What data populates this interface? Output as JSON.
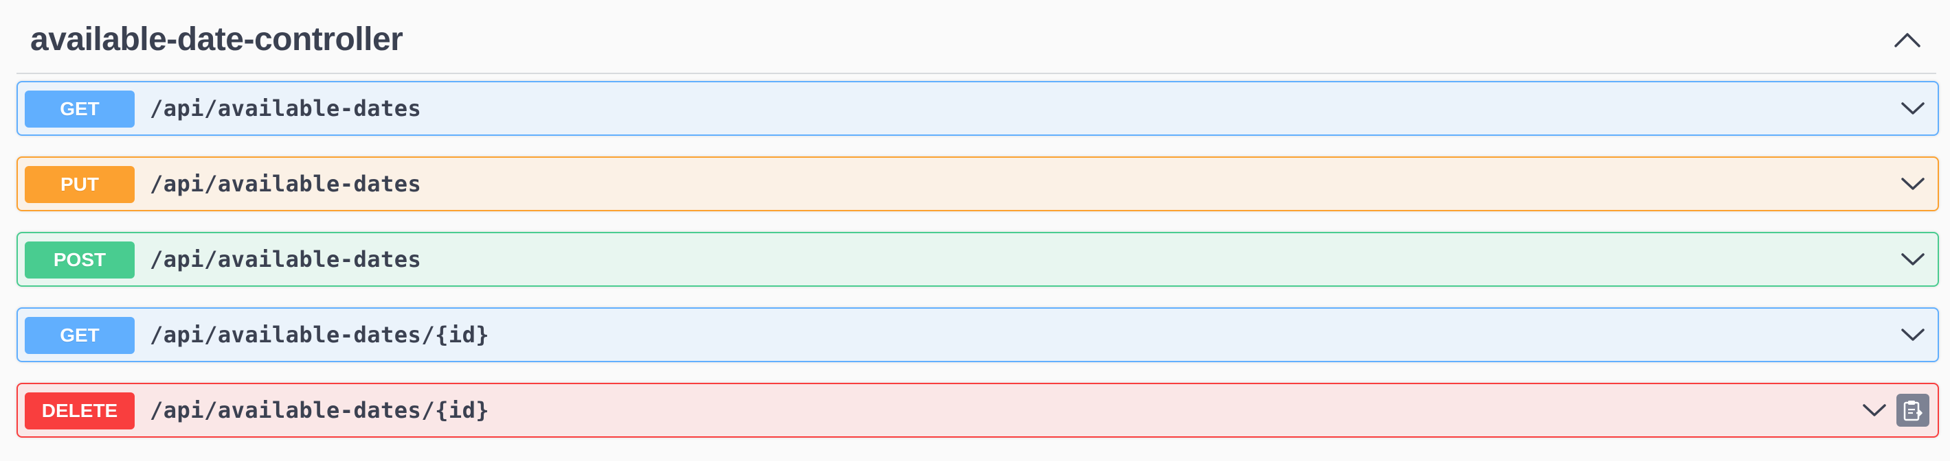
{
  "section": {
    "title": "available-date-controller"
  },
  "operations": [
    {
      "method": "GET",
      "path": "/api/available-dates"
    },
    {
      "method": "PUT",
      "path": "/api/available-dates"
    },
    {
      "method": "POST",
      "path": "/api/available-dates"
    },
    {
      "method": "GET",
      "path": "/api/available-dates/{id}"
    },
    {
      "method": "DELETE",
      "path": "/api/available-dates/{id}"
    }
  ],
  "icons": {
    "section_toggle": "chevron-up-icon",
    "operation_expand": "chevron-down-icon",
    "copy": "clipboard-copy-icon"
  },
  "colors": {
    "get": "#61affe",
    "put": "#fca130",
    "post": "#49cc90",
    "delete": "#f93e3e",
    "text": "#3b4151"
  }
}
